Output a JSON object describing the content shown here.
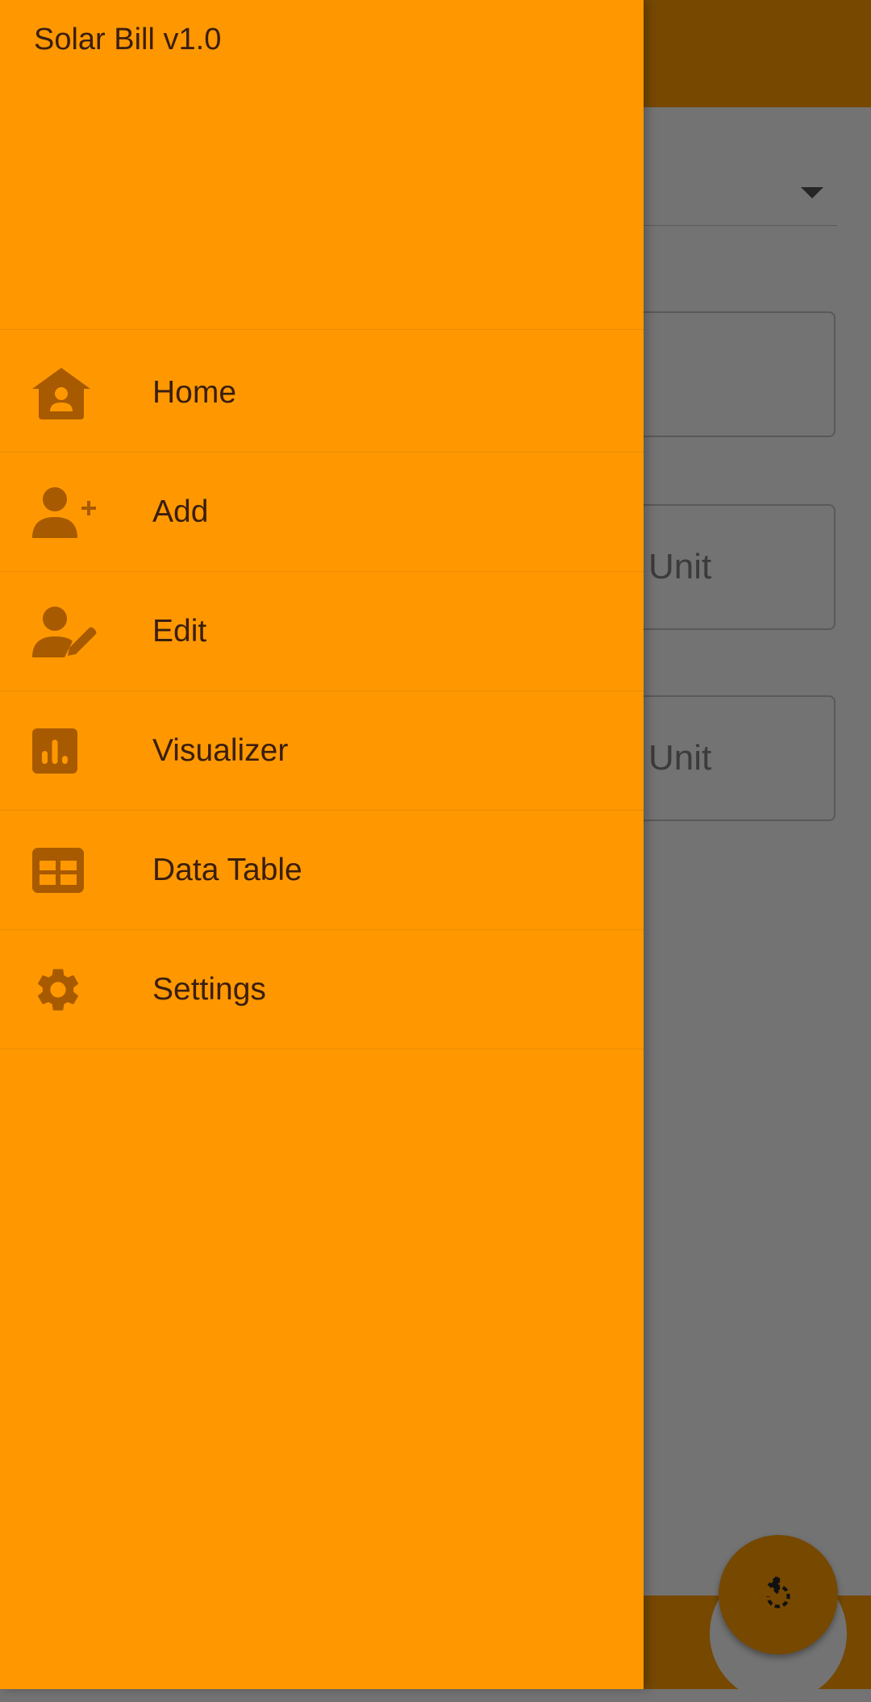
{
  "drawer": {
    "title": "Solar Bill v1.0",
    "items": [
      {
        "label": "Home",
        "icon": "home-person-icon"
      },
      {
        "label": "Add",
        "icon": "person-add-icon"
      },
      {
        "label": "Edit",
        "icon": "person-edit-icon"
      },
      {
        "label": "Visualizer",
        "icon": "bar-chart-icon"
      },
      {
        "label": "Data Table",
        "icon": "table-icon"
      },
      {
        "label": "Settings",
        "icon": "gear-icon"
      }
    ]
  },
  "background": {
    "field2_suffix": "Unit",
    "field3_suffix": "Unit"
  },
  "colors": {
    "drawer": "#ff9800",
    "icon": "#a85a00",
    "text": "#3a1e10",
    "app_bar": "#764800",
    "scrim": "#737373"
  }
}
